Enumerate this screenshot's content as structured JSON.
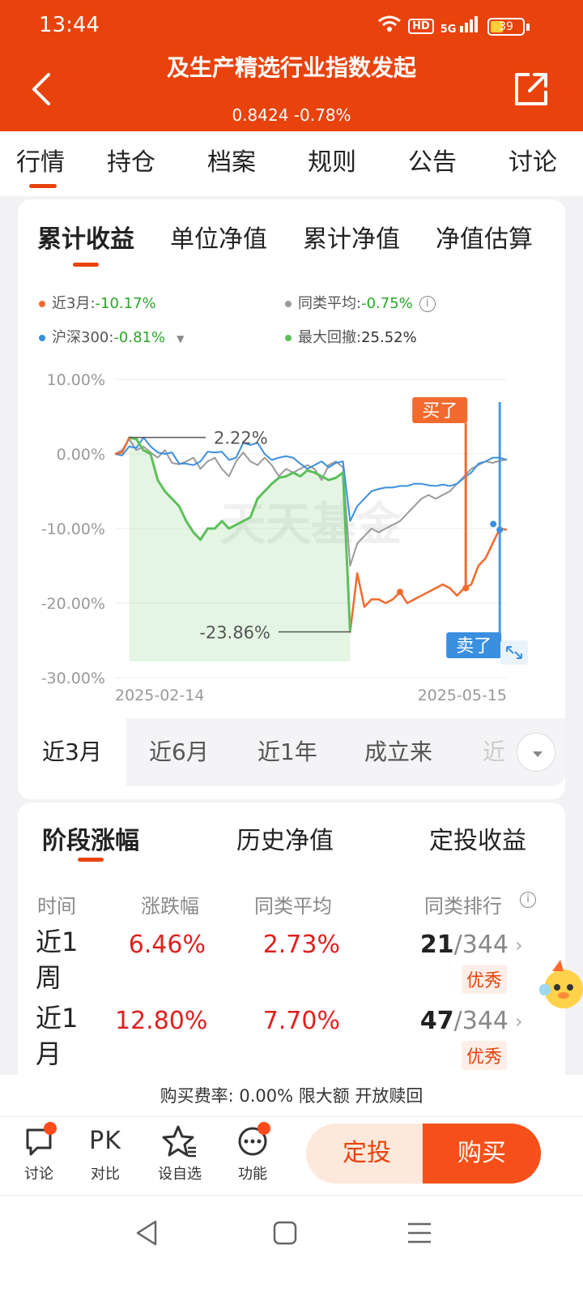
{
  "status": {
    "time": "13:44",
    "hd": "HD",
    "signal": "5G",
    "battery": "39",
    "battery_level": 0.39
  },
  "header": {
    "title": "及生产精选行业指数发起",
    "nav": "0.8424 -0.78%"
  },
  "top_tabs": [
    "行情",
    "持仓",
    "档案",
    "规则",
    "公告",
    "讨论"
  ],
  "chart_tabs": [
    "累计收益",
    "单位净值",
    "累计净值",
    "净值估算"
  ],
  "legend": {
    "fund_label": "近3月:",
    "fund_value": "-10.17%",
    "avg_label": "同类平均:",
    "avg_value": "-0.75%",
    "index_label": "沪深300:",
    "index_value": "-0.81%",
    "drawdown_label": "最大回撤:",
    "drawdown_value": "25.52%"
  },
  "chart_data": {
    "type": "line",
    "x_start": "2025-02-14",
    "x_end": "2025-05-15",
    "yticks": [
      "10.00%",
      "0.00%",
      "-10.00%",
      "-20.00%",
      "-30.00%"
    ],
    "ylim": [
      -30,
      10
    ],
    "annotations": {
      "max": "2.22%",
      "min": "-23.86%",
      "buy": "买了",
      "sell": "卖了"
    },
    "watermark": "天天基金",
    "colors": {
      "fund": "#f26a2e",
      "avg": "#9a9a9a",
      "index": "#3a8fe0",
      "drawdown": "#5cc05c"
    },
    "series": [
      {
        "key": "fund",
        "values": [
          0,
          0.2,
          2.2,
          2.0,
          0.5,
          0,
          -3.5,
          -5,
          -6,
          -7,
          -9,
          -10.5,
          -11.5,
          -10,
          -10,
          -9,
          -10,
          -9.5,
          -9,
          -8.5,
          -6,
          -5,
          -4,
          -3.2,
          -3,
          -2.5,
          -3,
          -2.2,
          -2.5,
          -3,
          -3.5,
          -3.2,
          -2.5,
          -23.86,
          -16,
          -20.5,
          -19.5,
          -19.5,
          -20,
          -19.5,
          -18.5,
          -20,
          -19.5,
          -19,
          -18.5,
          -18,
          -17.5,
          -18,
          -19,
          -18,
          -17.5,
          -15,
          -14,
          -12,
          -10,
          -10.17
        ]
      },
      {
        "key": "avg",
        "values": [
          0,
          0.5,
          2.0,
          0.5,
          1.0,
          0.2,
          -0.5,
          0.5,
          -1.2,
          -1.4,
          -1.0,
          -0.5,
          -2.0,
          -1.0,
          -0.5,
          -2.0,
          -3.0,
          -1.0,
          0.2,
          -1.0,
          -1.5,
          -0.5,
          -1.5,
          -3.0,
          -2.0,
          -2.5,
          -2.0,
          -1.5,
          -2.0,
          -3.5,
          -1.5,
          -1.0,
          -1.8,
          -15,
          -12,
          -11,
          -10,
          -10.5,
          -10,
          -9.5,
          -9,
          -8,
          -7,
          -6,
          -5.5,
          -6,
          -5.5,
          -5,
          -4,
          -3,
          -2,
          -1.5,
          -1,
          -1.2,
          -0.9,
          -0.75
        ]
      },
      {
        "key": "index",
        "values": [
          0,
          -0.2,
          1.0,
          0.8,
          2.2,
          1.0,
          0.2,
          0.0,
          0.2,
          -1.3,
          -1.3,
          -1.5,
          -1.0,
          0.3,
          0.2,
          0.3,
          -0.8,
          -0.5,
          1.5,
          1.2,
          1.5,
          0.0,
          -0.8,
          -0.5,
          -0.3,
          -0.5,
          -1.3,
          -2.0,
          -1.5,
          -1.0,
          -1.8,
          -1.2,
          -1.0,
          -9,
          -7,
          -6,
          -5,
          -4.7,
          -4.5,
          -4.5,
          -4.3,
          -4.3,
          -4.0,
          -4.0,
          -4.2,
          -4.3,
          -4.1,
          -4.3,
          -4.0,
          -3.2,
          -2.5,
          -1.3,
          -1.0,
          -0.5,
          -0.5,
          -0.81
        ]
      },
      {
        "key": "drawdown",
        "values": [
          0,
          0.2,
          2.2,
          2.0,
          0.5,
          0,
          -3.5,
          -5,
          -6,
          -7,
          -9,
          -10.5,
          -11.5,
          -10,
          -10,
          -9,
          -10,
          -9.5,
          -9,
          -8.5,
          -6,
          -5,
          -4,
          -3.2,
          -3,
          -2.5,
          -3,
          -2.2,
          -2.5,
          -3,
          -3.5,
          -3.2,
          -2.5,
          -23.86
        ]
      }
    ]
  },
  "periods": [
    "近3月",
    "近6月",
    "近1年",
    "成立来",
    "近"
  ],
  "returns_tabs": [
    "阶段涨幅",
    "历史净值",
    "定投收益"
  ],
  "returns_headers": [
    "时间",
    "涨跌幅",
    "同类平均",
    "同类排行"
  ],
  "returns_rows": [
    {
      "label": "近1周",
      "change": "6.46%",
      "avg": "2.73%",
      "rank": "21",
      "total": "/344",
      "level": "优秀"
    },
    {
      "label": "近1月",
      "change": "12.80%",
      "avg": "7.70%",
      "rank": "47",
      "total": "/344",
      "level": "优秀"
    }
  ],
  "fee_line": "购买费率: 0.00% 限大额 开放赎回",
  "bottom_bar": {
    "discuss": "讨论",
    "pk": "PK",
    "compare": "对比",
    "watch": "设自选",
    "functions": "功能",
    "fixed": "定投",
    "buy": "购买"
  }
}
